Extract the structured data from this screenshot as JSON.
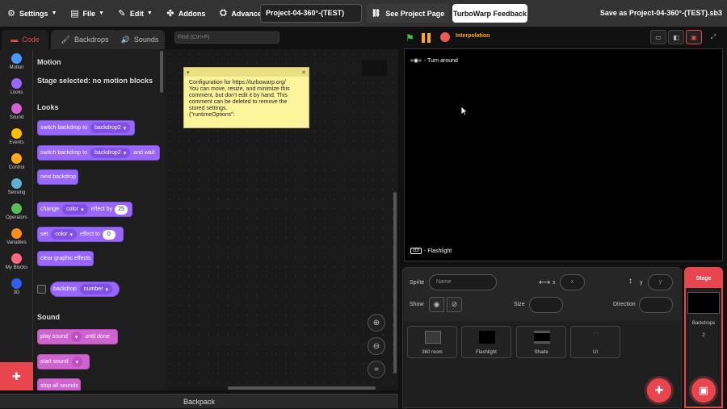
{
  "menubar": {
    "settings": "Settings",
    "file": "File",
    "edit": "Edit",
    "addons": "Addons",
    "advanced": "Advanced",
    "project_title": "Project-04-360°-(TEST)",
    "see_project": "See Project Page",
    "feedback": "TurboWarp Feedback",
    "save_as": "Save as Project-04-360°-(TEST).sb3"
  },
  "tabs": {
    "code": "Code",
    "backdrops": "Backdrops",
    "sounds": "Sounds"
  },
  "categories": [
    "Motion",
    "Looks",
    "Sound",
    "Events",
    "Control",
    "Sensing",
    "Operators",
    "Variables",
    "My Blocks",
    "3D"
  ],
  "category_colors": [
    "#4c97ff",
    "#9966ff",
    "#cf63cf",
    "#ffbf00",
    "#ffab19",
    "#5cb1d6",
    "#59c059",
    "#ff8c1a",
    "#ff6680",
    "#2f5ef0"
  ],
  "palette": {
    "motion_head": "Motion",
    "motion_note": "Stage selected: no motion blocks",
    "looks_head": "Looks",
    "switch_backdrop": "switch backdrop to",
    "backdrop2": "backdrop2",
    "switch_backdrop_wait": "switch backdrop to",
    "and_wait": "and wait",
    "next_backdrop": "next backdrop",
    "change": "change",
    "color": "color",
    "effect_by": "effect by",
    "change_val": "25",
    "set": "set",
    "effect_to": "effect to",
    "set_val": "0",
    "clear_effects": "clear graphic effects",
    "backdrop": "backdrop",
    "number": "number",
    "sound_head": "Sound",
    "play_sound": "play sound",
    "until_done": "until done",
    "start_sound": "start sound",
    "stop_sounds": "stop all sounds"
  },
  "workspace": {
    "find_placeholder": "Find (Ctrl+F)",
    "comment": "Configuration for https://turbowarp.org/\nYou can move, resize, and minimize this comment, but don't edit it by hand. This comment can be deleted to remove the stored settings.\n{\"runtimeOptions\":"
  },
  "backpack": "Backpack",
  "stage_header": {
    "interpolation": "Interpolation"
  },
  "stage": {
    "turn_around": "- Turn around",
    "turn_keys": "«◉»",
    "ctrl_key": "ctrl",
    "flashlight": "- Flashlight"
  },
  "sprite_info": {
    "sprite_label": "Sprite",
    "name_placeholder": "Name",
    "x_label": "x",
    "x_placeholder": "x",
    "y_label": "y",
    "y_placeholder": "y",
    "show_label": "Show",
    "size_label": "Size",
    "direction_label": "Direction"
  },
  "sprites": [
    "360 room",
    "Flashlight",
    "Shade",
    "UI"
  ],
  "stage_selector": {
    "title": "Stage",
    "backdrops_label": "Backdrops",
    "backdrops_count": "2"
  }
}
